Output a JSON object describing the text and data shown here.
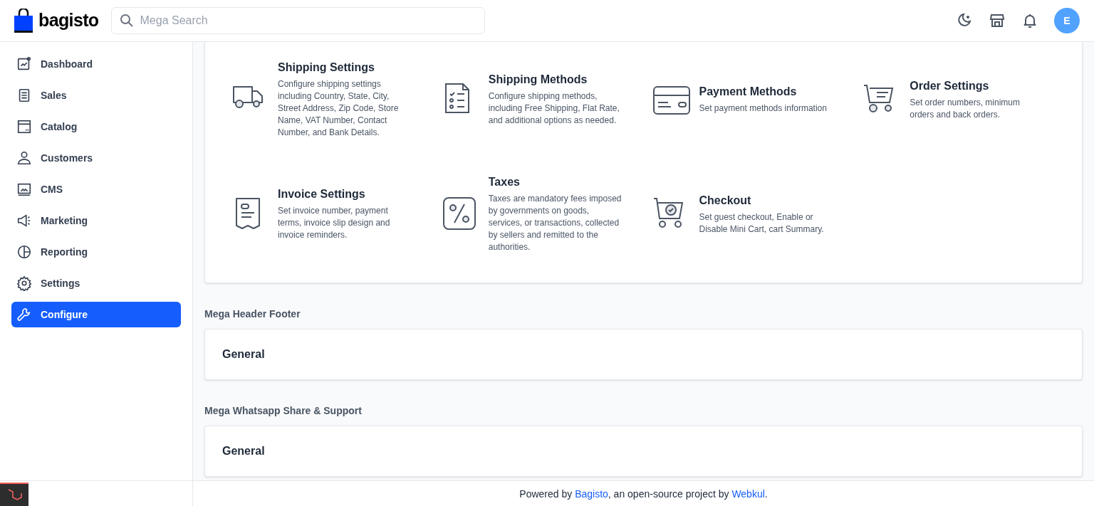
{
  "header": {
    "logo": "bagisto",
    "search": {
      "placeholder": "Mega Search"
    },
    "avatar": "E"
  },
  "sidebar": {
    "items": [
      {
        "label": "Dashboard",
        "selected": false
      },
      {
        "label": "Sales",
        "selected": false
      },
      {
        "label": "Catalog",
        "selected": false
      },
      {
        "label": "Customers",
        "selected": false
      },
      {
        "label": "CMS",
        "selected": false
      },
      {
        "label": "Marketing",
        "selected": false
      },
      {
        "label": "Reporting",
        "selected": false
      },
      {
        "label": "Settings",
        "selected": false
      },
      {
        "label": "Configure",
        "selected": true
      }
    ]
  },
  "config_items": [
    {
      "title": "Shipping Settings",
      "description": "Configure shipping settings including Country, State, City, Street Address, Zip Code, Store Name, VAT Number, Contact Number, and Bank Details."
    },
    {
      "title": "Shipping Methods",
      "description": "Configure shipping methods, including Free Shipping, Flat Rate, and additional options as needed."
    },
    {
      "title": "Payment Methods",
      "description": "Set payment methods information"
    },
    {
      "title": "Order Settings",
      "description": "Set order numbers, minimum orders and back orders."
    },
    {
      "title": "Invoice Settings",
      "description": "Set invoice number, payment terms, invoice slip design and invoice reminders."
    },
    {
      "title": "Taxes",
      "description": "Taxes are mandatory fees imposed by governments on goods, services, or transactions, collected by sellers and remitted to the authorities."
    },
    {
      "title": "Checkout",
      "description": "Set guest checkout, Enable or Disable Mini Cart, cart Summary."
    }
  ],
  "sections": [
    {
      "heading": "Mega Header Footer",
      "items": [
        "General"
      ]
    },
    {
      "heading": "Mega Whatsapp Share & Support",
      "items": [
        "General"
      ]
    }
  ],
  "footer": {
    "prefix": "Powered by ",
    "link_1": "Bagisto",
    "middle": ", an open-source project by ",
    "link_2": "Webkul",
    "suffix": "."
  }
}
